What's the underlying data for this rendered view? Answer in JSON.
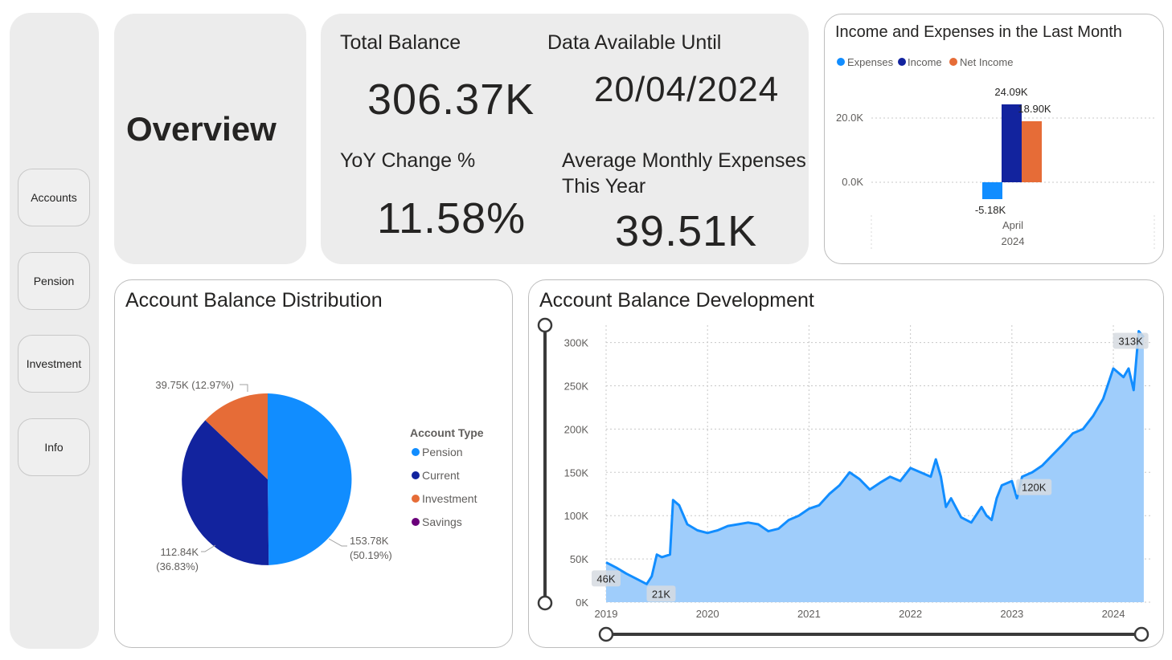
{
  "nav": {
    "items": [
      {
        "label": "Accounts"
      },
      {
        "label": "Pension"
      },
      {
        "label": "Investment"
      },
      {
        "label": "Info"
      }
    ]
  },
  "page": {
    "title": "Overview"
  },
  "kpis": {
    "total_balance": {
      "label": "Total Balance",
      "value": "306.37K"
    },
    "data_until": {
      "label": "Data Available Until",
      "value": "20/04/2024"
    },
    "yoy": {
      "label": "YoY Change %",
      "value": "11.58%"
    },
    "avg_expenses": {
      "label_line1": "Average Monthly Expenses",
      "label_line2": "This Year",
      "value": "39.51K"
    }
  },
  "income_chart": {
    "title": "Income and Expenses in the Last Month",
    "legend": [
      {
        "name": "Expenses",
        "color": "#118DFF"
      },
      {
        "name": "Income",
        "color": "#12239E"
      },
      {
        "name": "Net Income",
        "color": "#E66C37"
      }
    ],
    "x_label_1": "April",
    "x_label_2": "2024",
    "y_ticks": [
      "20.0K",
      "0.0K"
    ],
    "data_labels": [
      "-5.18K",
      "24.09K",
      "18.90K"
    ]
  },
  "distribution_chart": {
    "title": "Account Balance Distribution",
    "legend_title": "Account Type",
    "legend": [
      {
        "name": "Pension",
        "color": "#118DFF"
      },
      {
        "name": "Current",
        "color": "#12239E"
      },
      {
        "name": "Investment",
        "color": "#E66C37"
      },
      {
        "name": "Savings",
        "color": "#6B007B"
      }
    ],
    "labels": {
      "pension_1": "153.78K",
      "pension_2": "(50.19%)",
      "current_1": "112.84K",
      "current_2": "(36.83%)",
      "investment": "39.75K (12.97%)"
    }
  },
  "development_chart": {
    "title": "Account Balance Development",
    "y_ticks": [
      "300K",
      "250K",
      "200K",
      "150K",
      "100K",
      "50K",
      "0K"
    ],
    "x_ticks": [
      "2019",
      "2020",
      "2021",
      "2022",
      "2023",
      "2024"
    ],
    "annotations": [
      "46K",
      "21K",
      "120K",
      "313K"
    ]
  },
  "chart_data": [
    {
      "type": "bar",
      "title": "Income and Expenses in the Last Month",
      "categories": [
        "April 2024"
      ],
      "series": [
        {
          "name": "Expenses",
          "values": [
            -5.18
          ]
        },
        {
          "name": "Income",
          "values": [
            24.09
          ]
        },
        {
          "name": "Net Income",
          "values": [
            18.9
          ]
        }
      ],
      "unit": "K",
      "ylim": [
        -7,
        28
      ]
    },
    {
      "type": "pie",
      "title": "Account Balance Distribution",
      "categories": [
        "Pension",
        "Current",
        "Investment",
        "Savings"
      ],
      "values": [
        153.78,
        112.84,
        39.75,
        0
      ],
      "percent": [
        50.19,
        36.83,
        12.97,
        0
      ],
      "unit": "K"
    },
    {
      "type": "area",
      "title": "Account Balance Development",
      "x": [
        2019.0,
        2019.1,
        2019.2,
        2019.3,
        2019.4,
        2019.45,
        2019.5,
        2019.55,
        2019.63,
        2019.66,
        2019.72,
        2019.8,
        2019.9,
        2020.0,
        2020.1,
        2020.2,
        2020.3,
        2020.4,
        2020.5,
        2020.6,
        2020.7,
        2020.8,
        2020.9,
        2021.0,
        2021.1,
        2021.2,
        2021.3,
        2021.4,
        2021.5,
        2021.6,
        2021.7,
        2021.8,
        2021.9,
        2022.0,
        2022.1,
        2022.2,
        2022.25,
        2022.3,
        2022.35,
        2022.4,
        2022.5,
        2022.6,
        2022.7,
        2022.75,
        2022.8,
        2022.85,
        2022.9,
        2023.0,
        2023.05,
        2023.1,
        2023.2,
        2023.3,
        2023.4,
        2023.5,
        2023.6,
        2023.7,
        2023.8,
        2023.9,
        2024.0,
        2024.1,
        2024.15,
        2024.2,
        2024.25,
        2024.3
      ],
      "y": [
        46,
        40,
        33,
        27,
        21,
        30,
        55,
        52,
        55,
        118,
        112,
        90,
        83,
        80,
        83,
        88,
        90,
        92,
        90,
        82,
        85,
        95,
        100,
        108,
        112,
        125,
        135,
        150,
        142,
        130,
        138,
        145,
        140,
        155,
        150,
        145,
        165,
        145,
        110,
        120,
        98,
        92,
        110,
        100,
        95,
        120,
        135,
        140,
        120,
        145,
        150,
        158,
        170,
        182,
        195,
        200,
        215,
        235,
        270,
        260,
        270,
        245,
        313,
        306
      ],
      "xlabel": "",
      "ylabel": "",
      "ylim": [
        0,
        320
      ],
      "annotations": [
        {
          "x": 2019.0,
          "y": 46,
          "label": "46K"
        },
        {
          "x": 2019.4,
          "y": 21,
          "label": "21K"
        },
        {
          "x": 2022.9,
          "y": 120,
          "label": "120K"
        },
        {
          "x": 2024.25,
          "y": 313,
          "label": "313K"
        }
      ]
    }
  ]
}
